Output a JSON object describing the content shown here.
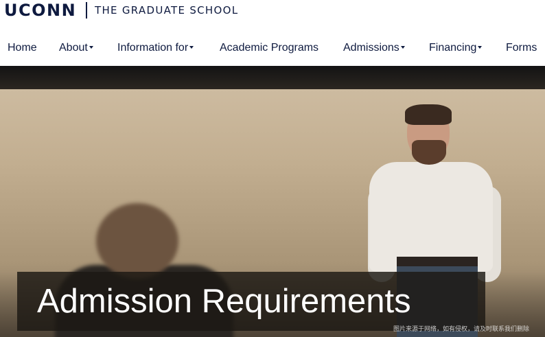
{
  "header": {
    "logo_text": "UCONN",
    "school_name": "THE GRADUATE SCHOOL"
  },
  "nav": {
    "items": [
      {
        "label": "Home",
        "has_dropdown": false
      },
      {
        "label": "About",
        "has_dropdown": true
      },
      {
        "label": "Information for",
        "has_dropdown": true
      },
      {
        "label": "Academic Programs",
        "has_dropdown": false
      },
      {
        "label": "Admissions",
        "has_dropdown": true
      },
      {
        "label": "Financing",
        "has_dropdown": true
      },
      {
        "label": "Forms",
        "has_dropdown": false
      }
    ]
  },
  "hero": {
    "title": "Admission Requirements",
    "watermark": "图片来源于网络，如有侵权，请及时联系我们删除"
  },
  "colors": {
    "brand_navy": "#0e1a3f",
    "title_overlay": "#1c1814",
    "title_text": "#ffffff"
  }
}
